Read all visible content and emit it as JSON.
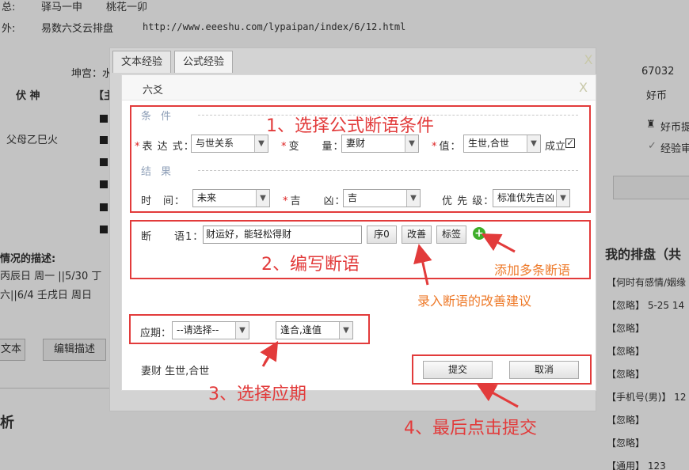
{
  "background": {
    "line1_label": "总:",
    "line1_a": "驿马一申",
    "line1_b": "桃花一卯",
    "line2_label": "外:",
    "line2_a": "易数六爻云排盘",
    "line2_url": "http://www.eeeshu.com/lypaipan/index/6/12.html",
    "kungong": "坤宫：水",
    "col_fushen": "伏 神",
    "col_zhu": "【主",
    "fumu": "父母乙巳火",
    "describe_label": "情况的描述:",
    "desc1": "丙辰日 周一 ||5/30 丁",
    "desc2": "六||6/4 壬戌日 周日",
    "btn_text": "文本",
    "btn_edit": "编辑描述",
    "bottom_left": "析",
    "right_num": "67032",
    "right_coin": "好币",
    "right_tip1": "好币提",
    "right_tip2": "经验审",
    "my_title": "我的排盘（共",
    "my_items": [
      "【何时有感情/姻缘",
      "【忽略】 5-25 14",
      "【忽略】",
      "【忽略】",
      "【忽略】",
      "【手机号(男)】 12",
      "【忽略】",
      "【忽略】",
      "【通用】 123"
    ]
  },
  "tabs": {
    "text": "文本经验",
    "formula": "公式经验"
  },
  "dialog": {
    "title": "六爻",
    "cond_section": "条件",
    "expr_label": "表 达 式：",
    "expr_value": "与世关系",
    "var_label": "变　　量：",
    "var_value": "妻财",
    "val_label": "值：",
    "val_value": "生世,合世",
    "chengli_label": "成立",
    "result_section": "结果",
    "time_label": "时　间：",
    "time_value": "未来",
    "jixiong_label": "吉　　凶：",
    "jixiong_value": "吉",
    "priority_label": "优 先 级：",
    "priority_value": "标准优先吉凶",
    "duanyu_label": "断　　语1：",
    "duanyu_value": "财运好，能轻松得财",
    "seq_btn": "序0",
    "improve_btn": "改善",
    "tag_btn": "标签",
    "yingqi_label": "应期：",
    "yingqi_value": "--请选择--",
    "feng_value": "逢合,逢值",
    "summary": "妻财 生世,合世",
    "submit_btn": "提交",
    "cancel_btn": "取消"
  },
  "annotations": {
    "step1": "1、选择公式断语条件",
    "step2": "2、编写断语",
    "step3": "3、选择应期",
    "step4": "4、最后点击提交",
    "add_multi": "添加多条断语",
    "improve_tip": "录入断语的改善建议"
  },
  "colors": {
    "annotation_red": "#e23b3b",
    "annotation_orange": "#ee7a2a",
    "plus_green": "#3fae2a"
  }
}
